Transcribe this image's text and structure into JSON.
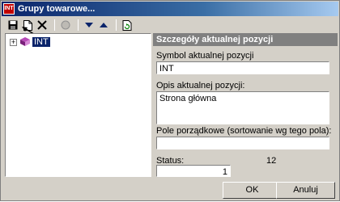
{
  "window": {
    "title": "Grupy towarowe...",
    "app_icon_text": "INT"
  },
  "toolbar": {
    "icons": [
      "save-icon",
      "new-document-icon",
      "delete-icon",
      "disabled-icon",
      "arrow-down-icon",
      "arrow-up-icon",
      "refresh-icon"
    ]
  },
  "tree": {
    "expander": "+",
    "root_label": "INT"
  },
  "details": {
    "header": "Szczegóły aktualnej pozycji",
    "symbol_label": "Symbol aktualnej pozycji",
    "symbol_value": "INT",
    "desc_label": "Opis aktualnej pozycji:",
    "desc_value": "Strona główna",
    "order_label": "Pole porządkowe (sortowanie wg tego pola):",
    "order_value": "",
    "status_label": "Status:",
    "status_count": "12",
    "status_value": "1"
  },
  "buttons": {
    "ok": "OK",
    "cancel": "Anuluj"
  },
  "annotation": {
    "label": "1"
  },
  "colors": {
    "title_start": "#0a246a",
    "title_end": "#a6caf0",
    "panel_bg": "#d4d0c8",
    "header_bg": "#808080",
    "selection": "#0a246a"
  }
}
